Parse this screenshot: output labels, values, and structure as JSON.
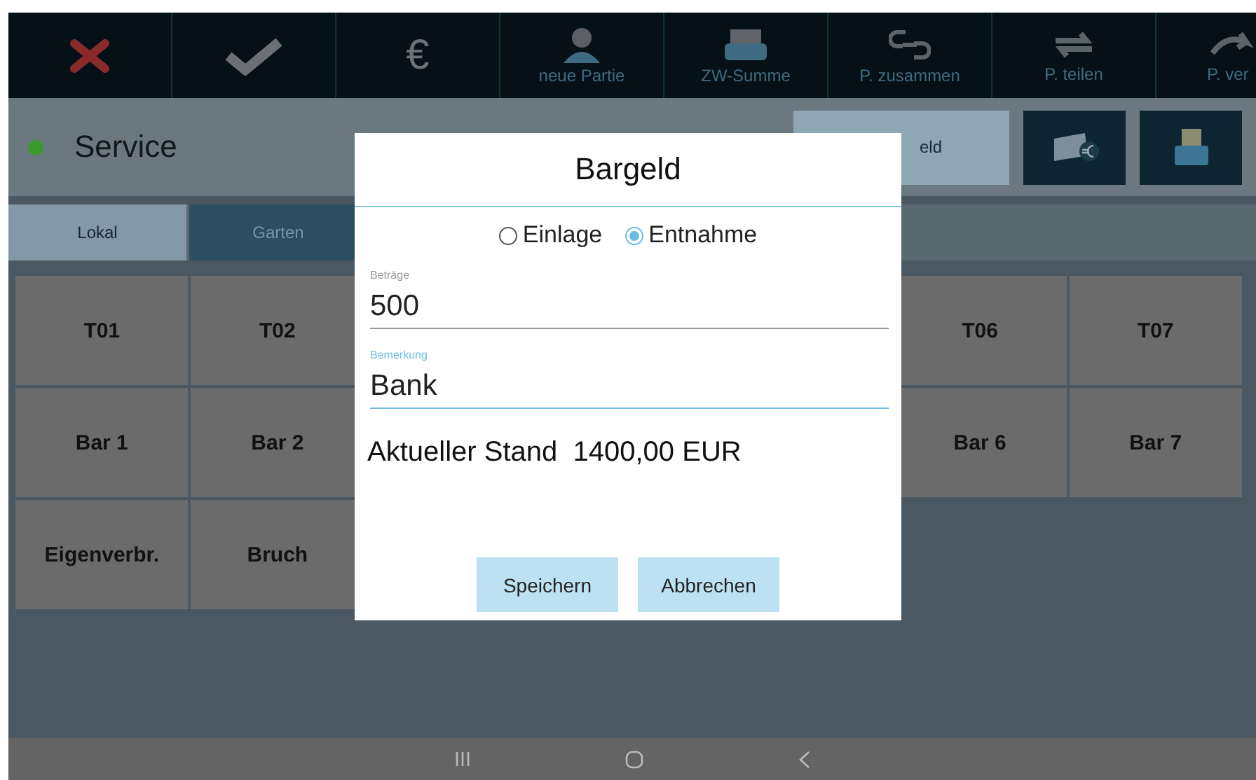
{
  "toolbar": [
    {
      "kind": "cancel"
    },
    {
      "kind": "confirm"
    },
    {
      "kind": "euro",
      "symbol": "€"
    },
    {
      "kind": "person",
      "label": "neue Partie"
    },
    {
      "kind": "printer",
      "label": "ZW-Summe"
    },
    {
      "kind": "link",
      "label": "P. zusammen"
    },
    {
      "kind": "swap",
      "label": "P. teilen"
    },
    {
      "kind": "move",
      "label": "P. ver"
    }
  ],
  "header": {
    "status": {
      "online": true,
      "label": "Service"
    },
    "cash_button": "eld"
  },
  "tabs": [
    {
      "label": "Lokal",
      "selected": true
    },
    {
      "label": "Garten",
      "selected": false
    }
  ],
  "tables": [
    {
      "left": [
        {
          "label": "T01"
        },
        {
          "label": "T02"
        }
      ],
      "right": [
        {
          "label": "T06"
        },
        {
          "label": "T07"
        }
      ]
    },
    {
      "left": [
        {
          "label": "Bar 1"
        },
        {
          "label": "Bar 2"
        }
      ],
      "right": [
        {
          "label": "Bar 6"
        },
        {
          "label": "Bar 7"
        }
      ]
    },
    {
      "left": [
        {
          "label": "Eigenverbr."
        },
        {
          "label": "Bruch"
        }
      ]
    }
  ],
  "dialog": {
    "title": "Bargeld",
    "options": [
      {
        "label": "Einlage",
        "selected": false
      },
      {
        "label": "Entnahme",
        "selected": true
      }
    ],
    "fields": [
      {
        "label": "Beträge",
        "value": "500",
        "focused": false
      },
      {
        "label": "Bemerkung",
        "value": "Bank",
        "focused": true
      }
    ],
    "balance": "Aktueller Stand  1400,00 EUR",
    "buttons": [
      "Speichern",
      "Abbrechen"
    ]
  }
}
